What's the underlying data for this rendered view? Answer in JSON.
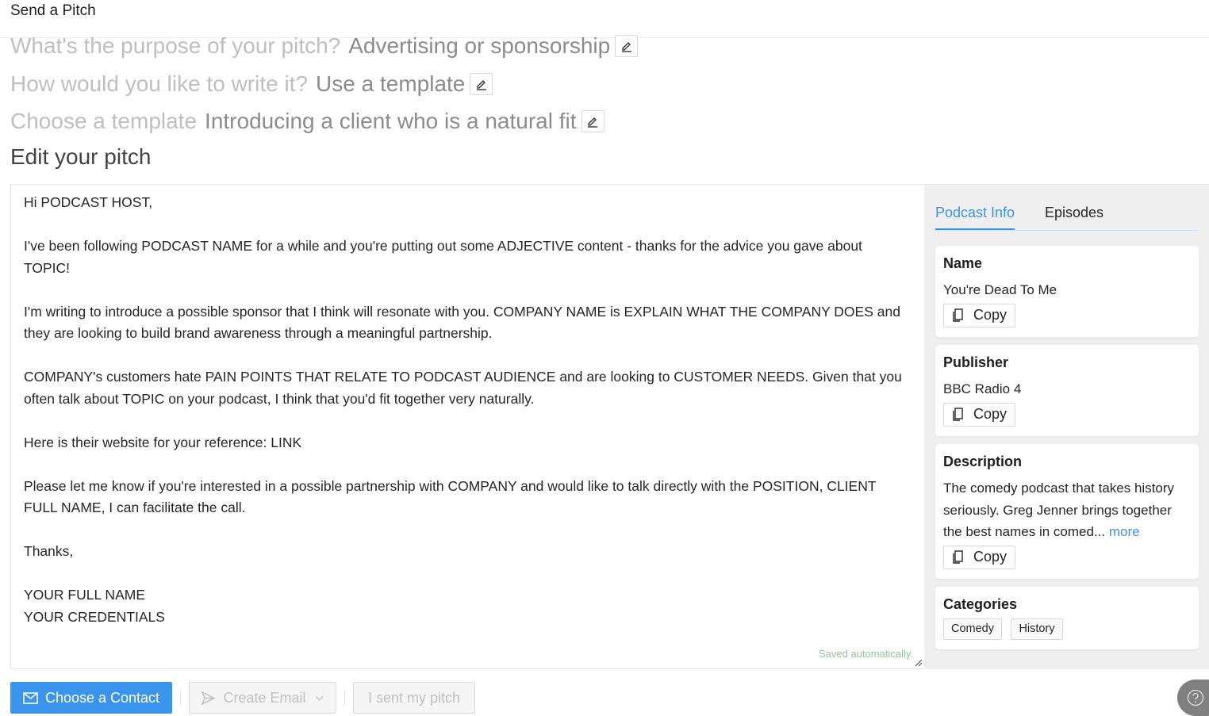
{
  "header": {
    "title": "Send a Pitch"
  },
  "steps": [
    {
      "question": "What's the purpose of your pitch?",
      "answer": "Advertising or sponsorship"
    },
    {
      "question": "How would you like to write it?",
      "answer": "Use a template"
    },
    {
      "question": "Choose a template",
      "answer": "Introducing a client who is a natural fit"
    }
  ],
  "editor": {
    "section_title": "Edit your pitch",
    "body": "Hi PODCAST HOST,\n\nI've been following PODCAST NAME for a while and you're putting out some ADJECTIVE content - thanks for the advice you gave about TOPIC!\n\nI'm writing to introduce a possible sponsor that I think will resonate with you. COMPANY NAME is EXPLAIN WHAT THE COMPANY DOES and they are looking to build brand awareness through a meaningful partnership.\n\nCOMPANY's customers hate PAIN POINTS THAT RELATE TO PODCAST AUDIENCE and are looking to CUSTOMER NEEDS. Given that you often talk about TOPIC on your podcast, I think that you'd fit together very naturally.\n\nHere is their website for your reference: LINK\n\nPlease let me know if you're interested in a possible partnership with COMPANY and would like to talk directly with the POSITION, CLIENT FULL NAME, I can facilitate the call.\n\nThanks,\n\nYOUR FULL NAME\nYOUR CREDENTIALS",
    "status": "Saved automatically."
  },
  "side": {
    "tabs": [
      {
        "label": "Podcast Info",
        "active": true
      },
      {
        "label": "Episodes",
        "active": false
      }
    ],
    "name": {
      "label": "Name",
      "value": "You're Dead To Me",
      "copy_label": "Copy"
    },
    "publisher": {
      "label": "Publisher",
      "value": "BBC Radio 4",
      "copy_label": "Copy"
    },
    "description": {
      "label": "Description",
      "value": "The comedy podcast that takes history seriously. Greg Jenner brings together the best names in comed...",
      "more_label": "more",
      "copy_label": "Copy"
    },
    "categories": {
      "label": "Categories",
      "items": [
        "Comedy",
        "History"
      ]
    }
  },
  "footer": {
    "choose_contact": "Choose a Contact",
    "create_email": "Create Email",
    "sent_pitch": "I sent my pitch"
  },
  "colors": {
    "accent": "#3b94ec",
    "saved": "#95c39a"
  }
}
